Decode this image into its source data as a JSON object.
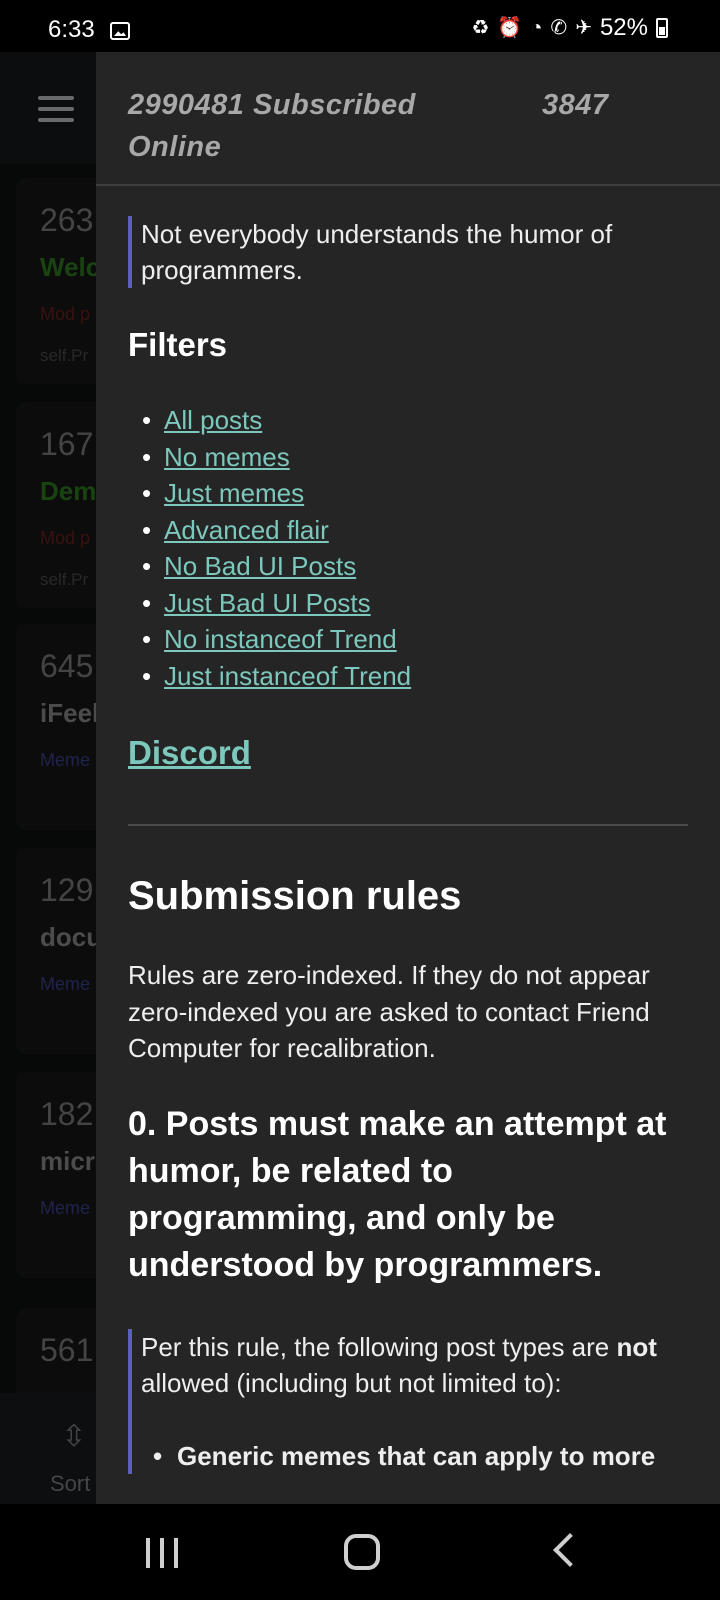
{
  "status_bar": {
    "time": "6:33",
    "battery": "52%",
    "icons": [
      "gallery-icon",
      "battery-saver-icon",
      "alarm-icon",
      "wifi-icon",
      "wifi-calling-icon",
      "airplane-icon",
      "battery-icon"
    ]
  },
  "background": {
    "posts": [
      {
        "num": "263",
        "title": "Welc",
        "meta": "Mod p",
        "src": "self.Pr",
        "title_color": "#2e7d1f",
        "meta_color": "#6b1f1f"
      },
      {
        "num": "167",
        "title": "Dem",
        "meta": "Mod p",
        "src": "self.Pr",
        "title_color": "#2e7d1f",
        "meta_color": "#6b1f1f"
      },
      {
        "num": "645",
        "title": "iFeel",
        "meta": "Meme",
        "src": "",
        "title_color": "#8a8a8a",
        "meta_color": "#3a3f8a"
      },
      {
        "num": "129",
        "title": "docu",
        "meta": "Meme",
        "src": "",
        "title_color": "#8a8a8a",
        "meta_color": "#3a3f8a"
      },
      {
        "num": "182",
        "title": "micr",
        "meta": "Meme",
        "src": "",
        "title_color": "#8a8a8a",
        "meta_color": "#3a3f8a"
      },
      {
        "num": "561",
        "title": "",
        "meta": "",
        "src": "",
        "title_color": "#8a8a8a",
        "meta_color": "#3a3f8a"
      }
    ],
    "sort_label": "Sort"
  },
  "drawer": {
    "subscribed": "2990481 Subscribed",
    "online_count": "3847",
    "online_label": "Online",
    "description": "Not everybody understands the humor of programmers.",
    "filters_heading": "Filters",
    "filters": [
      "All posts",
      "No memes",
      "Just memes",
      "Advanced flair",
      "No Bad UI Posts",
      "Just Bad UI Posts",
      "No instanceof Trend",
      "Just instanceof Trend"
    ],
    "discord": "Discord",
    "rules_heading": "Submission rules",
    "rules_intro": "Rules are zero-indexed. If they do not appear zero-indexed you are asked to contact Friend Computer for recalibration.",
    "rule0": "0. Posts must make an attempt at humor, be related to programming, and only be understood by programmers.",
    "rule0_quote_prefix": "Per this rule, the following post types are",
    "rule0_quote_bold": "not",
    "rule0_quote_suffix": "allowed (including but not limited to):",
    "rule0_bullet_1": "Generic memes that can apply to more"
  }
}
